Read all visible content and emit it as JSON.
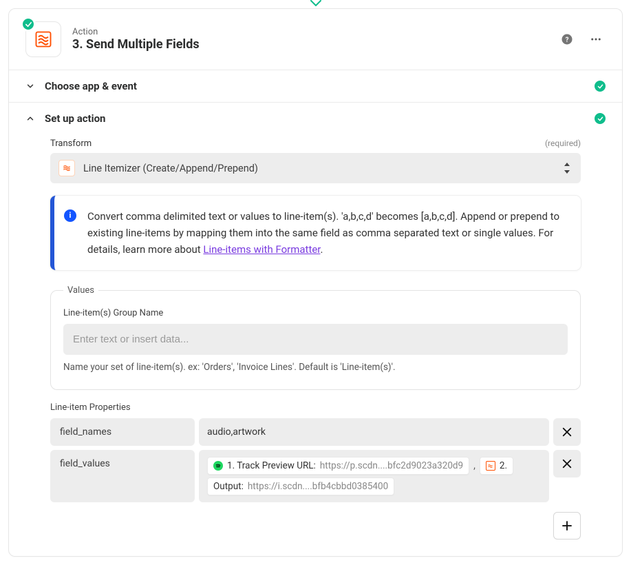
{
  "header": {
    "kicker": "Action",
    "title": "3. Send Multiple Fields"
  },
  "sections": {
    "choose": "Choose app & event",
    "setup": "Set up action"
  },
  "transform": {
    "label": "Transform",
    "required": "(required)",
    "value": "Line Itemizer (Create/Append/Prepend)"
  },
  "info": {
    "text_before_link": "Convert comma delimited text or values to line-item(s). 'a,b,c,d' becomes [a,b,c,d]. Append or prepend to existing line-items by mapping them into the same field as comma separated text or single values. For details, learn more about ",
    "link_text": "Line-items with Formatter",
    "text_after_link": "."
  },
  "values": {
    "legend": "Values",
    "group_label": "Line-item(s) Group Name",
    "placeholder": "Enter text or insert data...",
    "help": "Name your set of line-item(s). ex: 'Orders', 'Invoice Lines'. Default is 'Line-item(s)'."
  },
  "props": {
    "label": "Line-item Properties",
    "rows": [
      {
        "key": "field_names",
        "plain": "audio,artwork"
      },
      {
        "key": "field_values"
      }
    ],
    "pill_track_prefix": "1. Track Preview URL: ",
    "pill_track_val": "https://p.scdn....bfc2d9023a320d9",
    "pill2_prefix": "2.",
    "pill_output_prefix": "Output: ",
    "pill_output_val": "https://i.scdn....bfb4cbbd0385400",
    "comma": ","
  },
  "icons": {
    "help": "help-circle-icon",
    "more": "more-horizontal-icon",
    "check": "check-icon",
    "chevron_down": "chevron-down-icon",
    "chevron_up": "chevron-up-icon",
    "updown": "sort-icon",
    "close": "close-icon",
    "plus": "plus-icon",
    "formatter": "formatter-app-icon",
    "spotify": "spotify-icon"
  }
}
